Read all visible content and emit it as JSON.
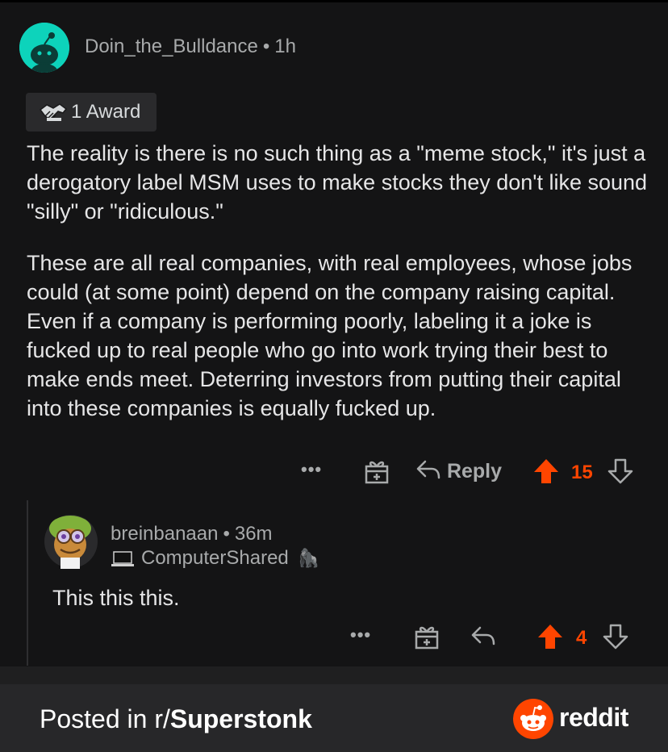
{
  "comment": {
    "username": "Doin_the_Bulldance",
    "separator": "•",
    "time": "1h",
    "award_label": "1 Award",
    "paragraphs": [
      "The reality is there is no such thing as a \"meme stock,\" it's just a derogatory label MSM uses to make stocks they don't like sound \"silly\" or \"ridiculous.\"",
      "These are all real companies, with real employees, whose jobs could (at some point) depend on the company raising capital. Even if a company is performing poorly, labeling it a joke is fucked up to real people who go into work trying their best to make ends meet. Deterring investors from putting their capital into these companies is equally fucked up."
    ],
    "actions": {
      "more": "•••",
      "reply_label": "Reply",
      "votes": "15"
    }
  },
  "reply": {
    "username": "breinbanaan",
    "separator": "•",
    "time": "36m",
    "flair": "ComputerShared",
    "flair_emoji": "🦍",
    "text": "This this this.",
    "actions": {
      "more": "•••",
      "votes": "4"
    }
  },
  "footer": {
    "posted_in_prefix": "Posted in r/",
    "subreddit": "Superstonk",
    "brand": "reddit"
  },
  "colors": {
    "upvote": "#ff4500",
    "background": "#141415",
    "text": "#e6e6e7",
    "muted": "#a8aaab"
  }
}
